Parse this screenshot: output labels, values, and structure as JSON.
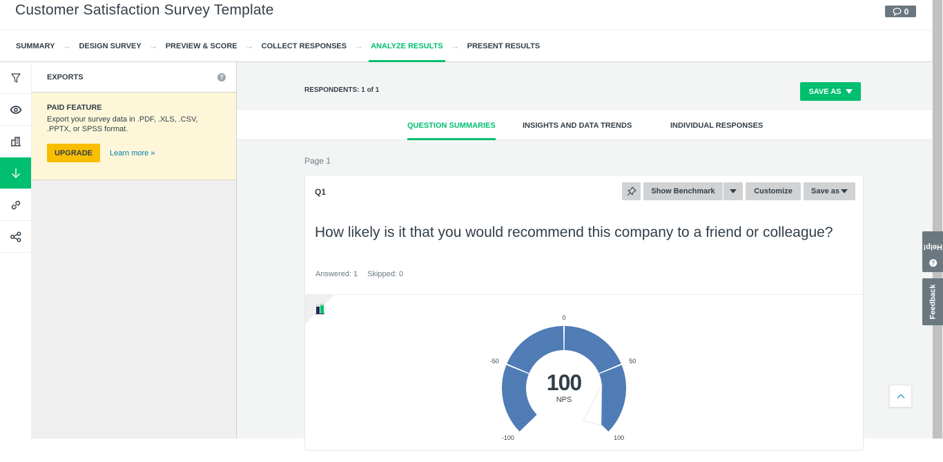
{
  "header": {
    "title": "Customer Satisfaction Survey Template",
    "comment_icon": "speech-bubble-icon",
    "comment_count": "0"
  },
  "nav": {
    "steps": [
      {
        "label": "SUMMARY",
        "active": false
      },
      {
        "label": "DESIGN SURVEY",
        "active": false
      },
      {
        "label": "PREVIEW & SCORE",
        "active": false
      },
      {
        "label": "COLLECT RESPONSES",
        "active": false
      },
      {
        "label": "ANALYZE RESULTS",
        "active": true
      },
      {
        "label": "PRESENT RESULTS",
        "active": false
      }
    ],
    "separator": "→"
  },
  "rail": {
    "items": [
      {
        "icon": "filter-icon",
        "active": false
      },
      {
        "icon": "eye-icon",
        "active": false
      },
      {
        "icon": "compare-icon",
        "active": false
      },
      {
        "icon": "download-icon",
        "active": true
      },
      {
        "icon": "link-icon",
        "active": false
      },
      {
        "icon": "share-icon",
        "active": false
      }
    ]
  },
  "exports": {
    "heading": "EXPORTS",
    "help": "?",
    "paid_title": "PAID FEATURE",
    "paid_desc": "Export your survey data in .PDF, .XLS, .CSV, .PPTX, or SPSS format.",
    "upgrade_label": "UPGRADE",
    "learn_more": "Learn more »"
  },
  "main": {
    "respondents": "RESPONDENTS: 1 of 1",
    "save_as": "SAVE AS",
    "tabs": [
      {
        "label": "QUESTION SUMMARIES",
        "active": true
      },
      {
        "label": "INSIGHTS AND DATA TRENDS",
        "active": false
      },
      {
        "label": "INDIVIDUAL RESPONSES",
        "active": false
      }
    ],
    "page_label": "Page 1"
  },
  "question": {
    "number": "Q1",
    "tools": {
      "pin_icon": "pin-icon",
      "show_benchmark": "Show Benchmark",
      "customize": "Customize",
      "save_as": "Save as"
    },
    "text": "How likely is it that you would recommend this company to a friend or colleague?",
    "answered": "Answered: 1",
    "skipped": "Skipped: 0"
  },
  "chart_data": {
    "type": "gauge",
    "title": "NPS",
    "value": 100,
    "value_label": "100",
    "unit_label": "NPS",
    "range": [
      -100,
      100
    ],
    "tick_labels": [
      "-100",
      "-50",
      "0",
      "50",
      "100"
    ],
    "segments": [
      {
        "from": -100,
        "to": -50
      },
      {
        "from": -50,
        "to": 0
      },
      {
        "from": 0,
        "to": 50
      },
      {
        "from": 50,
        "to": 100
      }
    ],
    "color": "#507cb6"
  },
  "side": {
    "help": "Help!",
    "feedback": "Feedback",
    "to_top_icon": "chevron-up-icon"
  }
}
